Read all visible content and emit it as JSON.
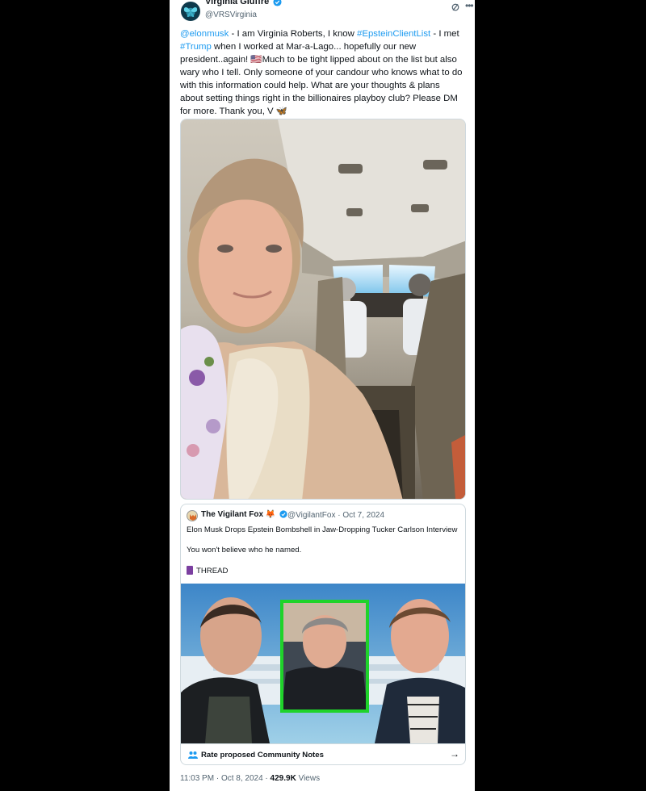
{
  "author": {
    "name": "Virginia Giuffre",
    "handle": "@VRSVirginia"
  },
  "tweet": {
    "mention": "@elonmusk",
    "text_a": " - I am Virginia Roberts, I know ",
    "hashtag1": "#EpsteinClientList",
    "text_b": " - I met ",
    "hashtag2": "#Trump",
    "text_c": " when I worked at Mar-a-Lago... hopefully our new president..again! 🇺🇸Much to be tight lipped about on the list but also wary who I tell. Only someone of your candour who knows what to do with this information could help. What are your thoughts & plans about setting things right in the billionaires playboy club? Please DM for more. Thank you, V 🦋"
  },
  "quote": {
    "name": "The Vigilant Fox 🦊",
    "meta": "@VigilantFox · Oct 7, 2024",
    "line1": "Elon Musk Drops Epstein Bombshell in Jaw-Dropping Tucker Carlson Interview",
    "line2": "You won't believe who he named.",
    "line3": "THREAD",
    "notes_label": "Rate proposed Community Notes",
    "notes_arrow": "→"
  },
  "footer": {
    "time": "11:03 PM · Oct 8, 2024 · ",
    "views": "429.9K",
    "views_label": " Views"
  },
  "colors": {
    "link": "#1d9bf0",
    "verified": "#1d9bf0",
    "highlight_box": "#1fd32a"
  },
  "icons": [
    "butterfly-avatar-icon",
    "verified-badge-icon",
    "grok-icon",
    "more-icon",
    "community-notes-icon",
    "arrow-right-icon",
    "thread-icon"
  ]
}
